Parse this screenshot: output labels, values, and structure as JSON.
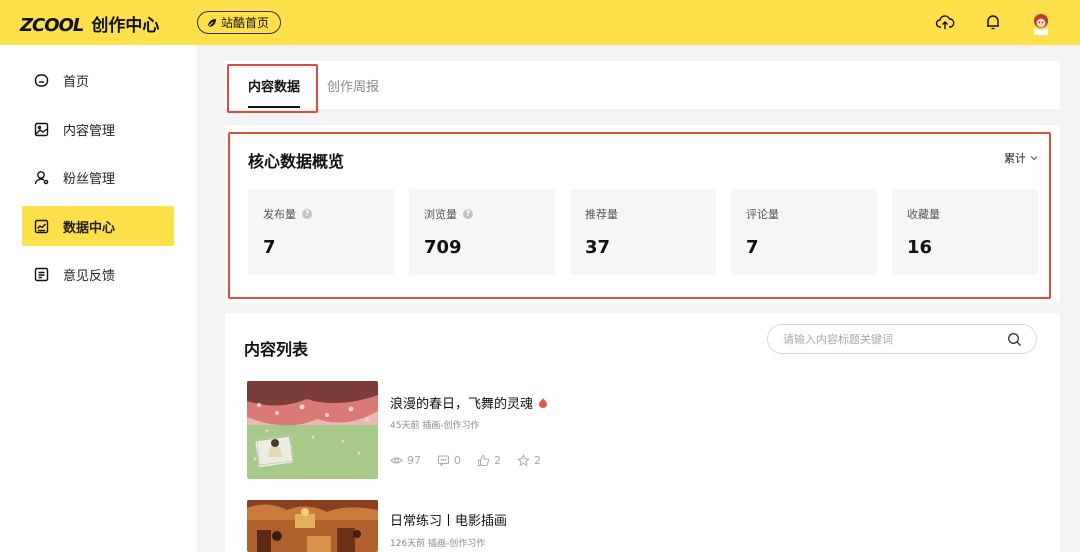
{
  "header": {
    "logo": "ZCOOL",
    "app_title": "创作中心",
    "home_button": "站酷首页",
    "icons": [
      "upload-cloud-icon",
      "bell-icon",
      "avatar"
    ],
    "accent_color": "#fde04a"
  },
  "sidebar": {
    "items": [
      {
        "label": "首页",
        "icon": "home-icon",
        "active": false
      },
      {
        "label": "内容管理",
        "icon": "image-icon",
        "active": false
      },
      {
        "label": "粉丝管理",
        "icon": "user-icon",
        "active": false
      },
      {
        "label": "数据中心",
        "icon": "chart-icon",
        "active": true
      },
      {
        "label": "意见反馈",
        "icon": "feedback-icon",
        "active": false
      }
    ]
  },
  "tabs": [
    {
      "label": "内容数据",
      "active": true
    },
    {
      "label": "创作周报",
      "active": false
    }
  ],
  "core": {
    "title": "核心数据概览",
    "period": "累计",
    "stats": [
      {
        "label": "发布量",
        "value": "7",
        "help": true
      },
      {
        "label": "浏览量",
        "value": "709",
        "help": true
      },
      {
        "label": "推荐量",
        "value": "37",
        "help": false
      },
      {
        "label": "评论量",
        "value": "7",
        "help": false
      },
      {
        "label": "收藏量",
        "value": "16",
        "help": false
      }
    ]
  },
  "content_list": {
    "title": "内容列表",
    "search_placeholder": "请输入内容标题关键词",
    "items": [
      {
        "title": "浪漫的春日，飞舞的灵魂",
        "meta": "45天前  插画-创作习作",
        "views": "97",
        "comments": "0",
        "likes": "2",
        "favorites": "2"
      },
      {
        "title": "日常练习丨电影插画",
        "meta": "126天前  插画-创作习作"
      }
    ]
  },
  "highlight_color": "#e04b3c"
}
